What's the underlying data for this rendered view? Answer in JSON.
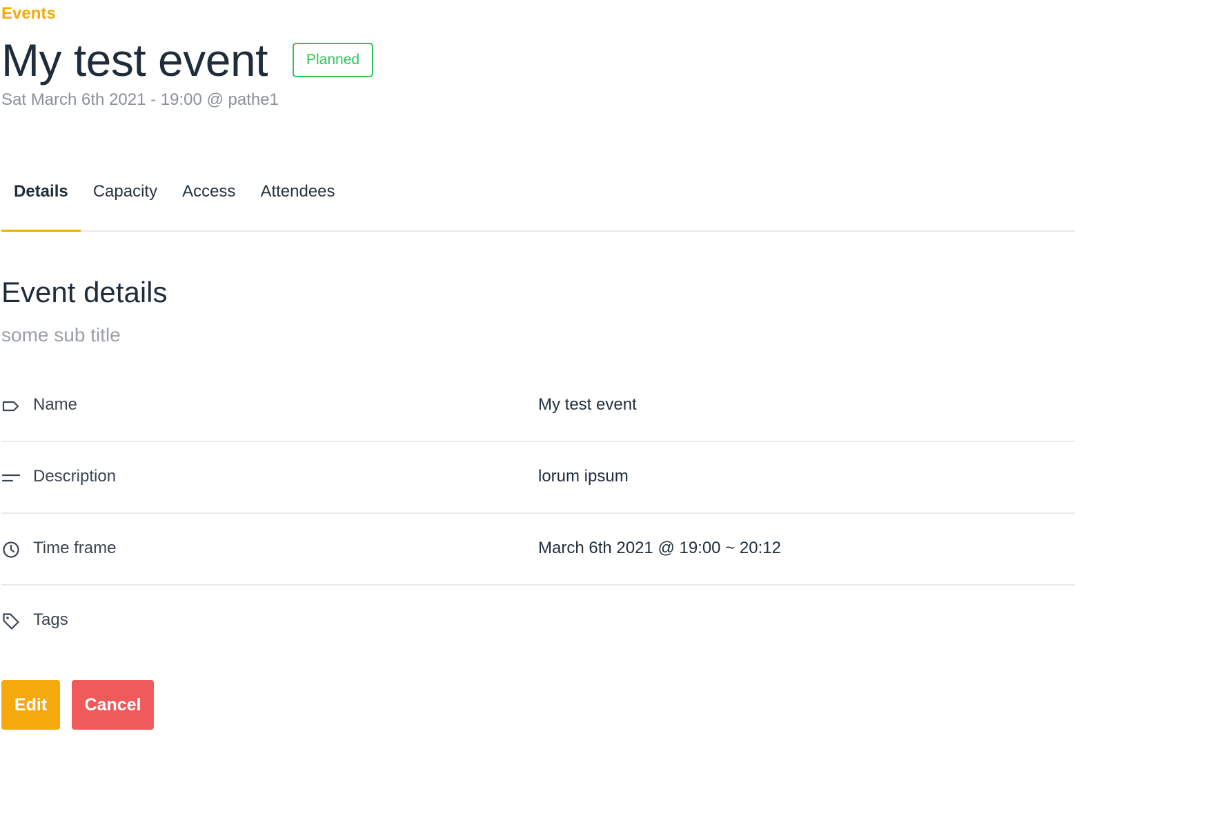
{
  "breadcrumb": {
    "label": "Events"
  },
  "header": {
    "title": "My test event",
    "status": "Planned",
    "subline": "Sat March 6th 2021 - 19:00 @ pathe1"
  },
  "tabs": [
    {
      "label": "Details",
      "active": true
    },
    {
      "label": "Capacity",
      "active": false
    },
    {
      "label": "Access",
      "active": false
    },
    {
      "label": "Attendees",
      "active": false
    }
  ],
  "section": {
    "title": "Event details",
    "subtitle": "some sub title"
  },
  "details": [
    {
      "icon": "label-icon",
      "label": "Name",
      "value": "My test event"
    },
    {
      "icon": "description-icon",
      "label": "Description",
      "value": "lorum ipsum"
    },
    {
      "icon": "clock-icon",
      "label": "Time frame",
      "value": "March 6th 2021 @ 19:00 ~ 20:12"
    },
    {
      "icon": "tag-icon",
      "label": "Tags",
      "value": ""
    }
  ],
  "actions": {
    "edit_label": "Edit",
    "cancel_label": "Cancel"
  },
  "colors": {
    "accent": "#f6a90d",
    "status_planned": "#2fc257",
    "danger": "#ef5a5a",
    "text_primary": "#1f2d3b",
    "text_muted": "#8a9096"
  }
}
